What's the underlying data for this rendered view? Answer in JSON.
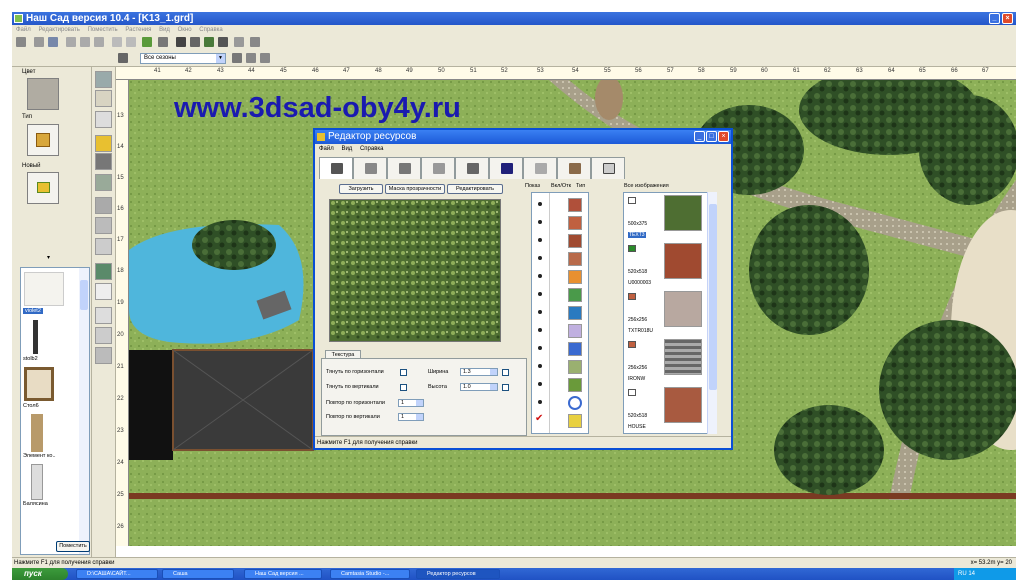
{
  "app": {
    "title": "Наш Сад версия 10.4 - [K13_1.grd]",
    "menu": [
      "Файл",
      "Редактировать",
      "Поместить",
      "Растения",
      "Вид",
      "Окно",
      "Справка"
    ],
    "season_select": "Все сезоны"
  },
  "left_panel": {
    "color_label": "Цвет",
    "type_label": "Тип",
    "new_label": "Новый",
    "items": [
      {
        "label": "violet2"
      },
      {
        "label": "stolb2"
      },
      {
        "label": "Стол6"
      },
      {
        "label": "Элемент ко.."
      },
      {
        "label": "Балясина"
      }
    ],
    "place_button": "Поместить"
  },
  "ruler": {
    "top_ticks": [
      "41",
      "42",
      "43",
      "44",
      "45",
      "46",
      "47",
      "48",
      "49",
      "50",
      "51",
      "52",
      "53",
      "54",
      "55",
      "56",
      "57",
      "58",
      "59",
      "60",
      "61",
      "62",
      "63",
      "64",
      "65",
      "66",
      "67"
    ],
    "left_ticks": [
      "13",
      "14",
      "15",
      "16",
      "17",
      "18",
      "19",
      "20",
      "21",
      "22",
      "23",
      "24",
      "25",
      "26"
    ]
  },
  "watermark": "www.3dsad-oby4y.ru",
  "status": {
    "hint": "Нажмите F1 для получения справки",
    "coords": "x= 53.2m  y= 20"
  },
  "taskbar": {
    "start": "пуск",
    "tasks": [
      "D:\\САША\\САЙТ...",
      "Саша",
      "Наш Сад версия ...",
      "Camtasia Studio -...",
      "Редактор ресурсов"
    ],
    "tray": "RU  14"
  },
  "dialog": {
    "title": "Редактор ресурсов",
    "menu": [
      "Файл",
      "Вид",
      "Справка"
    ],
    "buttons": {
      "load": "Загрузить",
      "mask": "Маска прозрачности",
      "edit": "Редактировать"
    },
    "columns": {
      "show": "Показ",
      "onoff": "Вкл/Отк",
      "type": "Тип",
      "all_images": "Все изображения"
    },
    "texture_tab": "Текстура",
    "stretch_h": "Тянуть по горизонтали",
    "stretch_v": "Тянуть по вертикали",
    "repeat_h": "Повтор по горизонтали",
    "repeat_v": "Повтор по вертикали",
    "width_label": "Ширина",
    "height_label": "Высота",
    "width_value": "1.3",
    "height_value": "1.0",
    "repeat_h_value": "1",
    "repeat_v_value": "1",
    "images": [
      {
        "size": "500x375",
        "name": "TEXT3"
      },
      {
        "size": "520x518",
        "name": "U0000003"
      },
      {
        "size": "256x256",
        "name": "TXTR018U"
      },
      {
        "size": "256x256",
        "name": "IRONW"
      },
      {
        "size": "520x518",
        "name": "HOUSE"
      }
    ],
    "status": "Нажмите F1 для получения справки"
  }
}
